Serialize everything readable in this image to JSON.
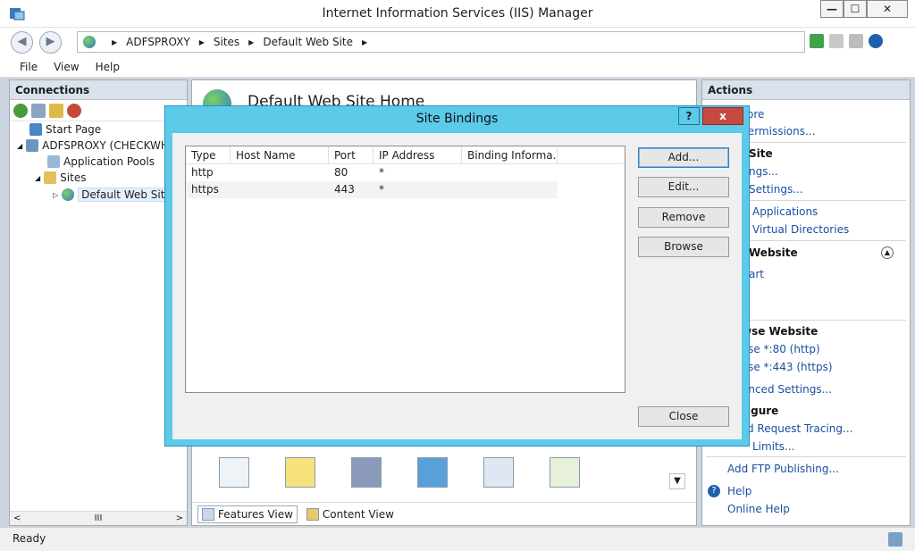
{
  "window": {
    "title": "Internet Information Services (IIS) Manager",
    "buttons": [
      "—",
      "☐",
      "✕"
    ]
  },
  "address": {
    "crumbs": [
      "ADFSPROXY",
      "Sites",
      "Default Web Site"
    ]
  },
  "menu": [
    "File",
    "View",
    "Help"
  ],
  "connections": {
    "header": "Connections",
    "tree": {
      "start_page": "Start Page",
      "server": "ADFSPROXY (CHECKWHA",
      "app_pools": "Application Pools",
      "sites": "Sites",
      "default_site": "Default Web Site"
    },
    "scroll_mid": "III"
  },
  "center": {
    "title": "Default Web Site Home",
    "features_view": "Features View",
    "content_view": "Content View"
  },
  "actions": {
    "header": "Actions",
    "items": {
      "explore": "ore",
      "edit_permissions": "Permissions...",
      "edit_site_hdr": "Site",
      "bindings": "ngs...",
      "basic_settings": "Settings...",
      "view_applications": "Applications",
      "view_vdirs": "Virtual Directories",
      "manage_website_hdr": "Website",
      "restart": "art",
      "browse_hdr": "wse Website",
      "browse_80": "vse *:80 (http)",
      "browse_443": "vse *:443 (https)",
      "advanced_settings": "anced Settings...",
      "configure_hdr": "igure",
      "failed_req": "d Request Tracing...",
      "limits": "Limits...",
      "add_ftp": "Add FTP Publishing...",
      "help": "Help",
      "online_help": "Online Help"
    }
  },
  "status": {
    "text": "Ready"
  },
  "dialog": {
    "title": "Site Bindings",
    "help_btn": "?",
    "close_btn": "x",
    "columns": [
      "Type",
      "Host Name",
      "Port",
      "IP Address",
      "Binding Informa..."
    ],
    "rows": [
      {
        "type": "http",
        "host": "",
        "port": "80",
        "ip": "*",
        "info": ""
      },
      {
        "type": "https",
        "host": "",
        "port": "443",
        "ip": "*",
        "info": ""
      }
    ],
    "buttons": {
      "add": "Add...",
      "edit": "Edit...",
      "remove": "Remove",
      "browse": "Browse",
      "close": "Close"
    }
  },
  "colors": {
    "dialog_frame": "#5ccae9",
    "close_red": "#c74a3f",
    "link_blue": "#1a4fa0"
  }
}
